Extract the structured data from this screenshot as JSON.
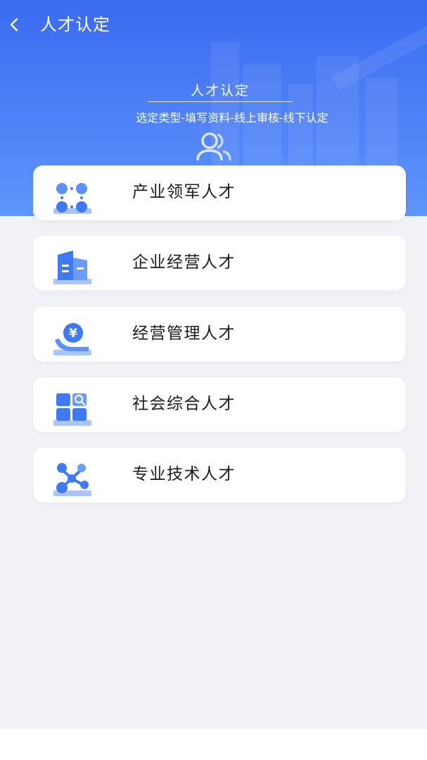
{
  "navbar": {
    "title": "人才认定",
    "back_icon": "chevron-left-icon"
  },
  "banner": {
    "title": "人才认定",
    "subtitle": "选定类型-填写资料-线上审核-线下认定",
    "icon": "users-icon"
  },
  "categories": [
    {
      "label": "产业领军人才",
      "icon": "dots-grid-icon"
    },
    {
      "label": "企业经营人才",
      "icon": "building-icon"
    },
    {
      "label": "经营管理人才",
      "icon": "yuan-hand-icon"
    },
    {
      "label": "社会综合人才",
      "icon": "grid-search-icon"
    },
    {
      "label": "专业技术人才",
      "icon": "network-icon"
    }
  ],
  "colors": {
    "primary": "#3a6bf0",
    "icon_blue": "#3f7af5",
    "icon_light": "#a9c4ff",
    "page_bg": "#f1f2f6",
    "card_bg": "#ffffff",
    "text": "#1c1c1e"
  }
}
